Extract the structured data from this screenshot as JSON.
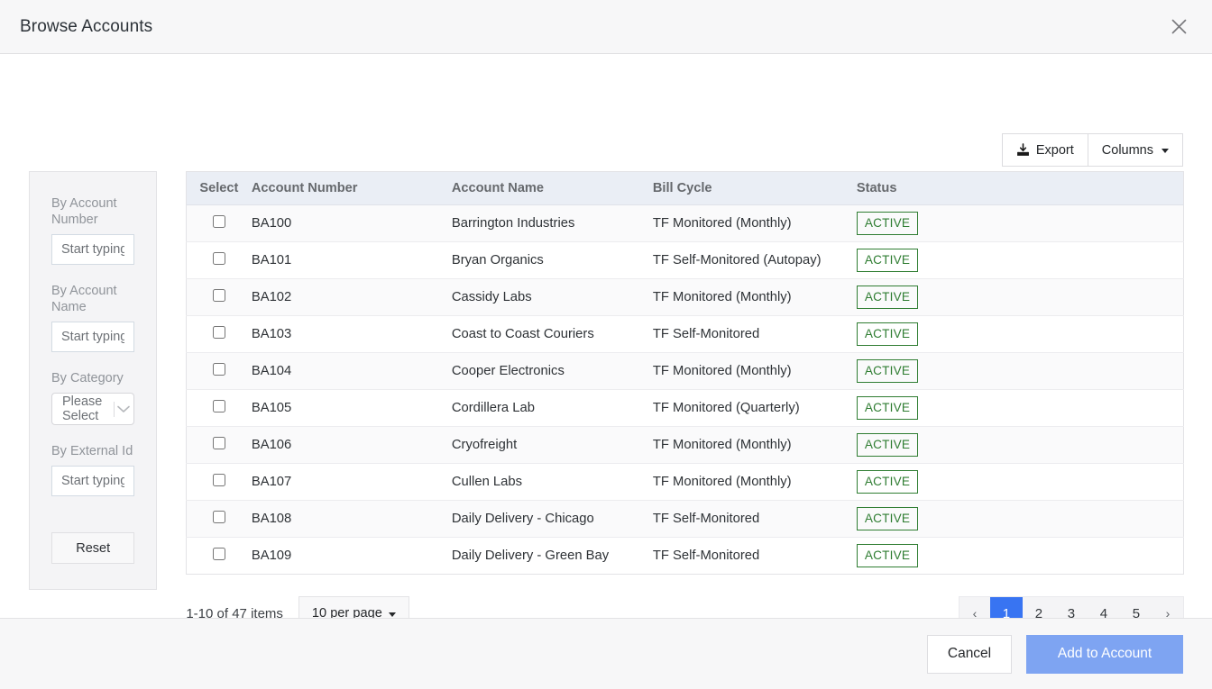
{
  "header": {
    "title": "Browse Accounts",
    "close_icon": "close-icon"
  },
  "toolbar": {
    "export_label": "Export",
    "export_icon": "download-icon",
    "columns_label": "Columns",
    "columns_caret_icon": "caret-down-icon"
  },
  "filters": {
    "account_number": {
      "label": "By Account Number",
      "value": "",
      "placeholder": "Start typing"
    },
    "account_name": {
      "label": "By Account Name",
      "value": "",
      "placeholder": "Start typing"
    },
    "category": {
      "label": "By Category",
      "selected": "Please Select",
      "chevron_icon": "chevron-down-icon"
    },
    "external_id": {
      "label": "By External Id",
      "value": "",
      "placeholder": "Start typing"
    },
    "reset_label": "Reset"
  },
  "table": {
    "columns": [
      "Select",
      "Account Number",
      "Account Name",
      "Bill Cycle",
      "Status"
    ],
    "rows": [
      {
        "selected": false,
        "account_number": "BA100",
        "account_name": "Barrington Industries",
        "bill_cycle": "TF Monitored (Monthly)",
        "status": "ACTIVE"
      },
      {
        "selected": false,
        "account_number": "BA101",
        "account_name": "Bryan Organics",
        "bill_cycle": "TF Self-Monitored (Autopay)",
        "status": "ACTIVE"
      },
      {
        "selected": false,
        "account_number": "BA102",
        "account_name": "Cassidy Labs",
        "bill_cycle": "TF Monitored (Monthly)",
        "status": "ACTIVE"
      },
      {
        "selected": false,
        "account_number": "BA103",
        "account_name": "Coast to Coast Couriers",
        "bill_cycle": "TF Self-Monitored",
        "status": "ACTIVE"
      },
      {
        "selected": false,
        "account_number": "BA104",
        "account_name": "Cooper Electronics",
        "bill_cycle": "TF Monitored (Monthly)",
        "status": "ACTIVE"
      },
      {
        "selected": false,
        "account_number": "BA105",
        "account_name": "Cordillera Lab",
        "bill_cycle": "TF Monitored (Quarterly)",
        "status": "ACTIVE"
      },
      {
        "selected": false,
        "account_number": "BA106",
        "account_name": "Cryofreight",
        "bill_cycle": "TF Monitored (Monthly)",
        "status": "ACTIVE"
      },
      {
        "selected": false,
        "account_number": "BA107",
        "account_name": "Cullen Labs",
        "bill_cycle": "TF Monitored (Monthly)",
        "status": "ACTIVE"
      },
      {
        "selected": false,
        "account_number": "BA108",
        "account_name": "Daily Delivery - Chicago",
        "bill_cycle": "TF Self-Monitored",
        "status": "ACTIVE"
      },
      {
        "selected": false,
        "account_number": "BA109",
        "account_name": "Daily Delivery - Green Bay",
        "bill_cycle": "TF Self-Monitored",
        "status": "ACTIVE"
      }
    ]
  },
  "pagination": {
    "info": "1-10 of 47 items",
    "per_page_label": "10 per page",
    "prev_icon": "‹",
    "next_icon": "›",
    "pages": [
      "1",
      "2",
      "3",
      "4",
      "5"
    ],
    "active_page": "1"
  },
  "footer": {
    "cancel_label": "Cancel",
    "primary_label": "Add to Account"
  },
  "colors": {
    "accent": "#3874f2",
    "primary_button": "#7ea4f2",
    "status_active": "#2f7d32",
    "header_bg": "#f7f7f8",
    "table_header_bg": "#eaeef5"
  }
}
